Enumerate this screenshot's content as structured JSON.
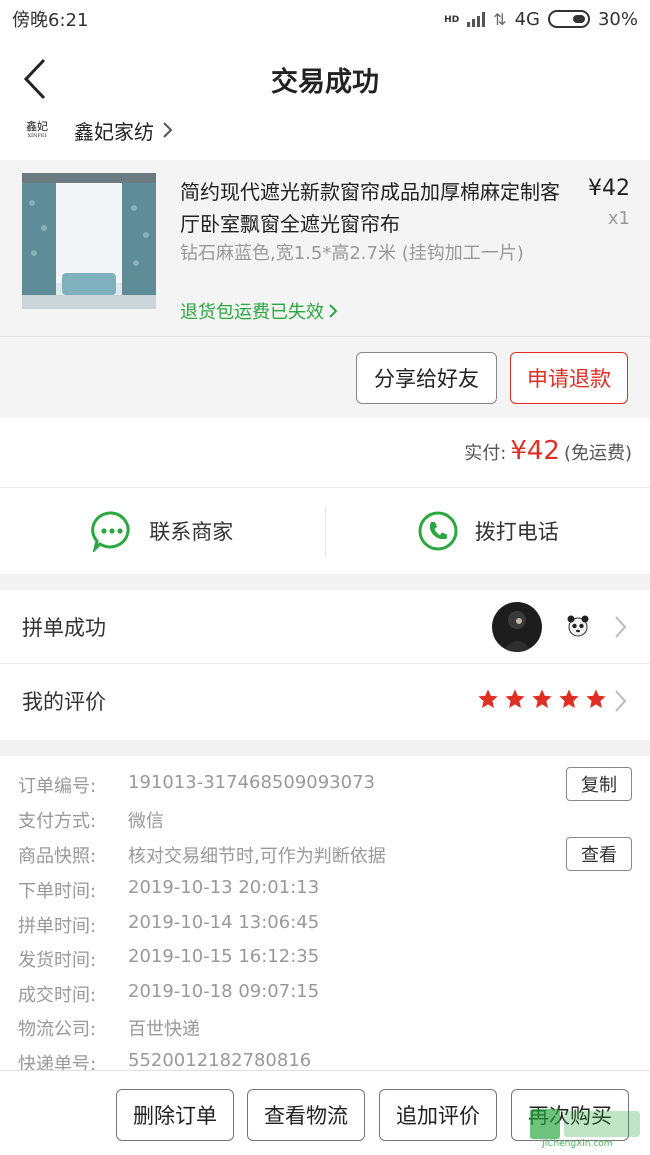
{
  "status_bar": {
    "time": "傍晚6:21",
    "hd": "HD",
    "network": "4G",
    "battery": "30%"
  },
  "nav": {
    "title": "交易成功"
  },
  "shop": {
    "logo_text": "鑫妃",
    "logo_sub": "XINFEI",
    "name": "鑫妃家纺"
  },
  "product": {
    "title": "简约现代遮光新款窗帘成品加厚棉麻定制客厅卧室飘窗全遮光窗帘布",
    "price": "¥42",
    "qty": "x1",
    "spec": "钻石麻蓝色,宽1.5*高2.7米 (挂钩加工一片)",
    "refund_shipping": "退货包运费已失效"
  },
  "actions": {
    "share": "分享给好友",
    "refund": "申请退款"
  },
  "payment": {
    "label": "实付:",
    "amount": "¥42",
    "note": "(免运费)"
  },
  "contact": {
    "merchant": "联系商家",
    "phone": "拨打电话"
  },
  "group": {
    "label": "拼单成功"
  },
  "review": {
    "label": "我的评价",
    "rating": 5
  },
  "details": {
    "order_no_label": "订单编号:",
    "order_no": "191013-317468509093073",
    "copy": "复制",
    "pay_method_label": "支付方式:",
    "pay_method": "微信",
    "snapshot_label": "商品快照:",
    "snapshot": "核对交易细节时,可作为判断依据",
    "view": "查看",
    "order_time_label": "下单时间:",
    "order_time": "2019-10-13 20:01:13",
    "group_time_label": "拼单时间:",
    "group_time": "2019-10-14 13:06:45",
    "ship_time_label": "发货时间:",
    "ship_time": "2019-10-15 16:12:35",
    "deal_time_label": "成交时间:",
    "deal_time": "2019-10-18 09:07:15",
    "carrier_label": "物流公司:",
    "carrier": "百世快递",
    "tracking_label": "快递单号:",
    "tracking": "5520012182780816"
  },
  "bottom": {
    "delete": "删除订单",
    "logistics": "查看物流",
    "add_review": "追加评价",
    "rebuy": "再次购买"
  },
  "watermark": {
    "text": "JiChengXin.com"
  },
  "colors": {
    "accent_red": "#e02e24",
    "green": "#2aa83e",
    "star_red": "#e02e24"
  }
}
